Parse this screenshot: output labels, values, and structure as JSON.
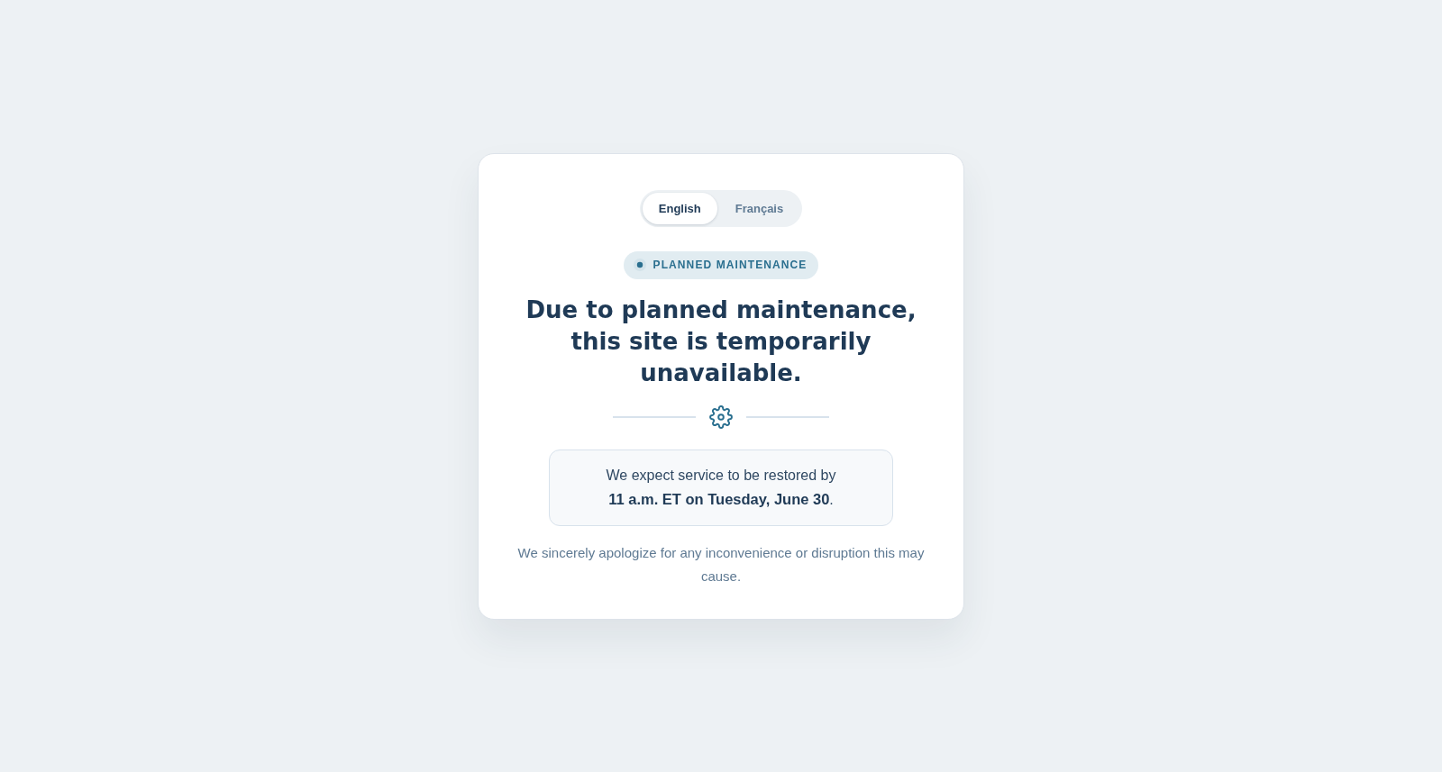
{
  "language_switcher": {
    "options": [
      {
        "label": "English",
        "selected": true
      },
      {
        "label": "Français",
        "selected": false
      }
    ]
  },
  "status_badge": {
    "label": "PLANNED MAINTENANCE"
  },
  "heading": "Due to planned maintenance, this site is temporarily unavailable.",
  "restore_notice": "We expect service to be restored by **11 a.m. ET on Tuesday, June 30**.",
  "apology": "We sincerely apologize for any inconvenience or disruption this may cause."
}
